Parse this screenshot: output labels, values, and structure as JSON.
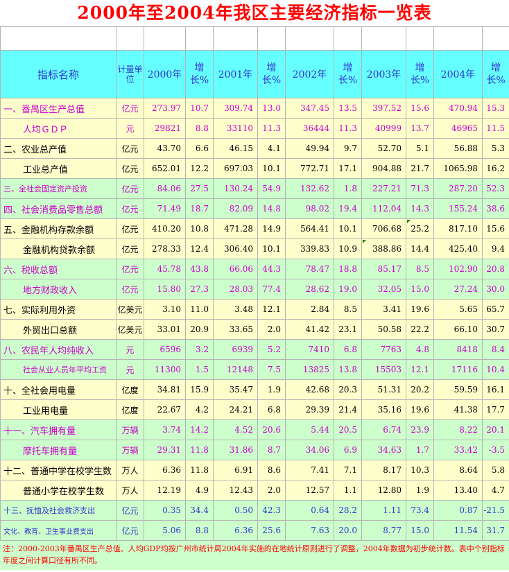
{
  "title": "2000年至2004年我区主要经济指标一览表",
  "headers": {
    "name": "指标名称",
    "unit": "计量单位",
    "y2000": "2000年",
    "y2001": "2001年",
    "y2002": "2002年",
    "y2003": "2003年",
    "y2004": "2004年",
    "growth": "增长%"
  },
  "rows": [
    {
      "name": "一、番禺区生产总值",
      "unit": "亿元",
      "v": [
        "273.97",
        "10.7",
        "309.74",
        "13.0",
        "347.45",
        "13.5",
        "397.52",
        "15.6",
        "470.94",
        "15.3"
      ]
    },
    {
      "name": "人均ＧＤＰ",
      "unit": "元",
      "v": [
        "29821",
        "8.8",
        "33110",
        "11.3",
        "36444",
        "11.3",
        "40999",
        "13.7",
        "46965",
        "11.5"
      ]
    },
    {
      "name": "二、农业总产值",
      "unit": "亿元",
      "v": [
        "43.70",
        "6.6",
        "46.15",
        "4.1",
        "49.94",
        "9.7",
        "52.70",
        "5.1",
        "56.88",
        "5.3"
      ]
    },
    {
      "name": "工业总产值",
      "unit": "亿元",
      "v": [
        "652.01",
        "12.2",
        "697.03",
        "10.1",
        "772.71",
        "17.1",
        "904.88",
        "21.7",
        "1065.98",
        "16.2"
      ]
    },
    {
      "name": "三、全社会固定资产投资",
      "unit": "亿元",
      "v": [
        "84.06",
        "27.5",
        "130.24",
        "54.9",
        "132.62",
        "1.8",
        "227.21",
        "71.3",
        "287.20",
        "52.3"
      ]
    },
    {
      "name": "四、社会消费品零售总额",
      "unit": "亿元",
      "v": [
        "71.49",
        "18.7",
        "82.09",
        "14.8",
        "98.02",
        "19.4",
        "112.04",
        "14.3",
        "155.24",
        "38.6"
      ]
    },
    {
      "name": "五、金融机构存款余额",
      "unit": "亿元",
      "v": [
        "410.20",
        "10.8",
        "471.28",
        "14.9",
        "564.41",
        "10.1",
        "706.68",
        "25.2",
        "817.10",
        "15.6"
      ]
    },
    {
      "name": "金融机构贷款余额",
      "unit": "亿元",
      "v": [
        "278.33",
        "12.4",
        "306.40",
        "10.1",
        "339.83",
        "10.9",
        "388.86",
        "14.4",
        "425.40",
        "9.4"
      ]
    },
    {
      "name": "六、税收总额",
      "unit": "亿元",
      "v": [
        "45.78",
        "43.8",
        "66.06",
        "44.3",
        "78.47",
        "18.8",
        "85.17",
        "8.5",
        "102.90",
        "20.8"
      ]
    },
    {
      "name": "地方财政收入",
      "unit": "亿元",
      "v": [
        "15.80",
        "27.3",
        "28.03",
        "77.4",
        "28.62",
        "19.0",
        "32.05",
        "15.0",
        "27.24",
        "30.0"
      ]
    },
    {
      "name": "七、实际利用外资",
      "unit": "亿美元",
      "v": [
        "3.10",
        "11.0",
        "3.48",
        "12.1",
        "2.84",
        "8.5",
        "3.41",
        "19.6",
        "5.65",
        "65.7"
      ]
    },
    {
      "name": "外贸出口总额",
      "unit": "亿美元",
      "v": [
        "33.01",
        "20.9",
        "33.65",
        "2.0",
        "41.42",
        "23.1",
        "50.58",
        "22.2",
        "66.10",
        "30.7"
      ]
    },
    {
      "name": "八、农民年人均纯收入",
      "unit": "元",
      "v": [
        "6596",
        "3.2",
        "6939",
        "5.2",
        "7410",
        "6.8",
        "7763",
        "4.8",
        "8418",
        "8.4"
      ]
    },
    {
      "name": "社会从业人员年平均工资",
      "unit": "元",
      "v": [
        "11300",
        "1.5",
        "12148",
        "7.5",
        "13825",
        "13.8",
        "15503",
        "12.1",
        "17116",
        "10.4"
      ]
    },
    {
      "name": "十、全社会用电量",
      "unit": "亿度",
      "v": [
        "34.81",
        "15.9",
        "35.47",
        "1.9",
        "42.68",
        "20.3",
        "51.31",
        "20.2",
        "59.59",
        "16.1"
      ]
    },
    {
      "name": "工业用电量",
      "unit": "亿度",
      "v": [
        "22.67",
        "4.2",
        "24.21",
        "6.8",
        "29.39",
        "21.4",
        "35.16",
        "19.6",
        "41.38",
        "17.7"
      ]
    },
    {
      "name": "十一、汽车拥有量",
      "unit": "万辆",
      "v": [
        "3.74",
        "14.2",
        "4.52",
        "20.6",
        "5.44",
        "20.5",
        "6.74",
        "23.9",
        "8.22",
        "20.1"
      ]
    },
    {
      "name": "摩托车拥有量",
      "unit": "万辆",
      "v": [
        "29.31",
        "11.8",
        "31.86",
        "8.7",
        "34.06",
        "6.9",
        "34.63",
        "1.7",
        "33.42",
        "-3.5"
      ]
    },
    {
      "name": "十二、普通中学在校学生数",
      "unit": "万人",
      "v": [
        "6.36",
        "11.8",
        "6.91",
        "8.6",
        "7.41",
        "7.1",
        "8.17",
        "10.3",
        "8.64",
        "5.8"
      ]
    },
    {
      "name": "普通小学在校学生数",
      "unit": "万人",
      "v": [
        "12.19",
        "4.9",
        "12.43",
        "2.0",
        "12.57",
        "1.1",
        "12.80",
        "1.9",
        "13.40",
        "4.7"
      ]
    },
    {
      "name": "十三、抚恤及社会救济支出",
      "unit": "亿元",
      "v": [
        "0.35",
        "34.4",
        "0.50",
        "42.3",
        "0.64",
        "28.2",
        "1.11",
        "73.4",
        "0.87",
        "-21.5"
      ]
    },
    {
      "name": "文化、教育、卫生事业费支出",
      "unit": "亿元",
      "v": [
        "5.06",
        "8.8",
        "6.36",
        "25.6",
        "7.63",
        "20.0",
        "8.77",
        "15.0",
        "11.54",
        "31.7"
      ]
    }
  ],
  "note": "注：2000-2003年番禺区生产总值、人均GDP均按广州市统计局2004年实施的在地统计原则进行了调整，2004年数据为初步统计数。表中个别指标年度之间计算口径有所不同。"
}
